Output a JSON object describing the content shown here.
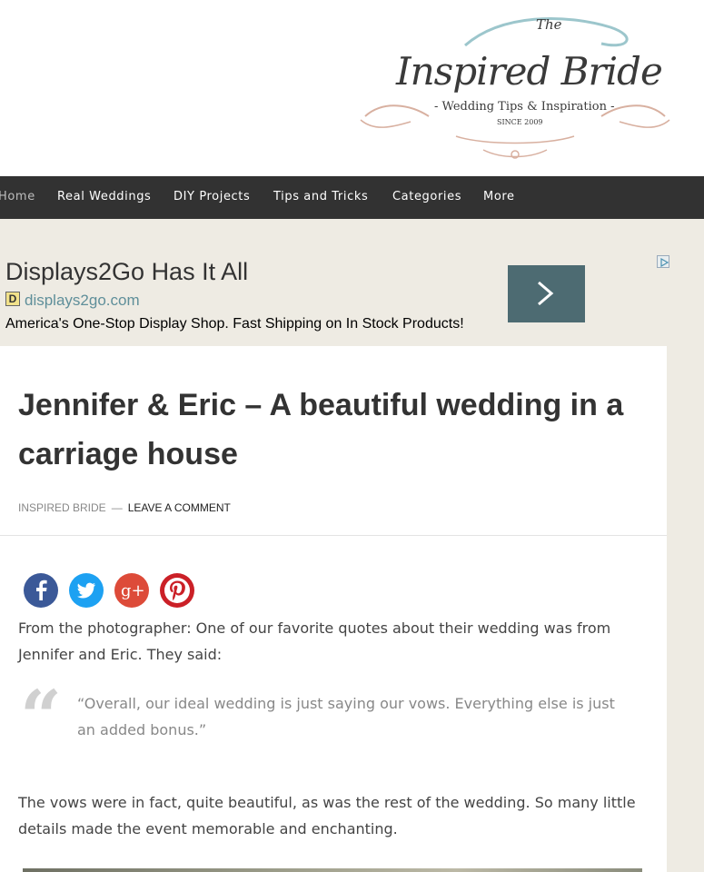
{
  "logo": {
    "the": "The",
    "name": "Inspired Bride",
    "tagline": "- Wedding Tips & Inspiration -",
    "since": "SINCE 2009"
  },
  "nav": {
    "items": [
      "Home",
      "Real Weddings",
      "DIY Projects",
      "Tips and Tricks",
      "Categories",
      "More"
    ]
  },
  "ad": {
    "title": "Displays2Go Has It All",
    "favicon_letter": "D",
    "domain": "displays2go.com",
    "description": "America's One-Stop Display Shop. Fast Shipping on In Stock Products!",
    "arrow_icon": "chevron-right-icon",
    "choices_icon": "adchoices-icon",
    "button_color": "#4d6b72"
  },
  "post": {
    "title": "Jennifer & Eric – A beautiful wedding in a carriage house",
    "author": "INSPIRED BRIDE",
    "separator": "—",
    "comment_link": "LEAVE A COMMENT",
    "share": [
      {
        "icon": "facebook-icon",
        "color": "#3b5998",
        "glyph": "f"
      },
      {
        "icon": "twitter-icon",
        "color": "#1da1f2",
        "glyph": ""
      },
      {
        "icon": "google-plus-icon",
        "color": "#dd4b39",
        "glyph": "g+"
      },
      {
        "icon": "pinterest-icon",
        "color": "#cb2027",
        "glyph": "p"
      }
    ],
    "intro": "From the photographer:  One of our favorite quotes about their wedding was from Jennifer and Eric. They said:",
    "quote_mark": "“",
    "quote": "“Overall, our ideal wedding is just saying our vows. Everything else is just an added bonus.”",
    "body": "The vows were in fact, quite beautiful, as was the rest of the wedding.  So many little details made the event memorable and enchanting."
  }
}
